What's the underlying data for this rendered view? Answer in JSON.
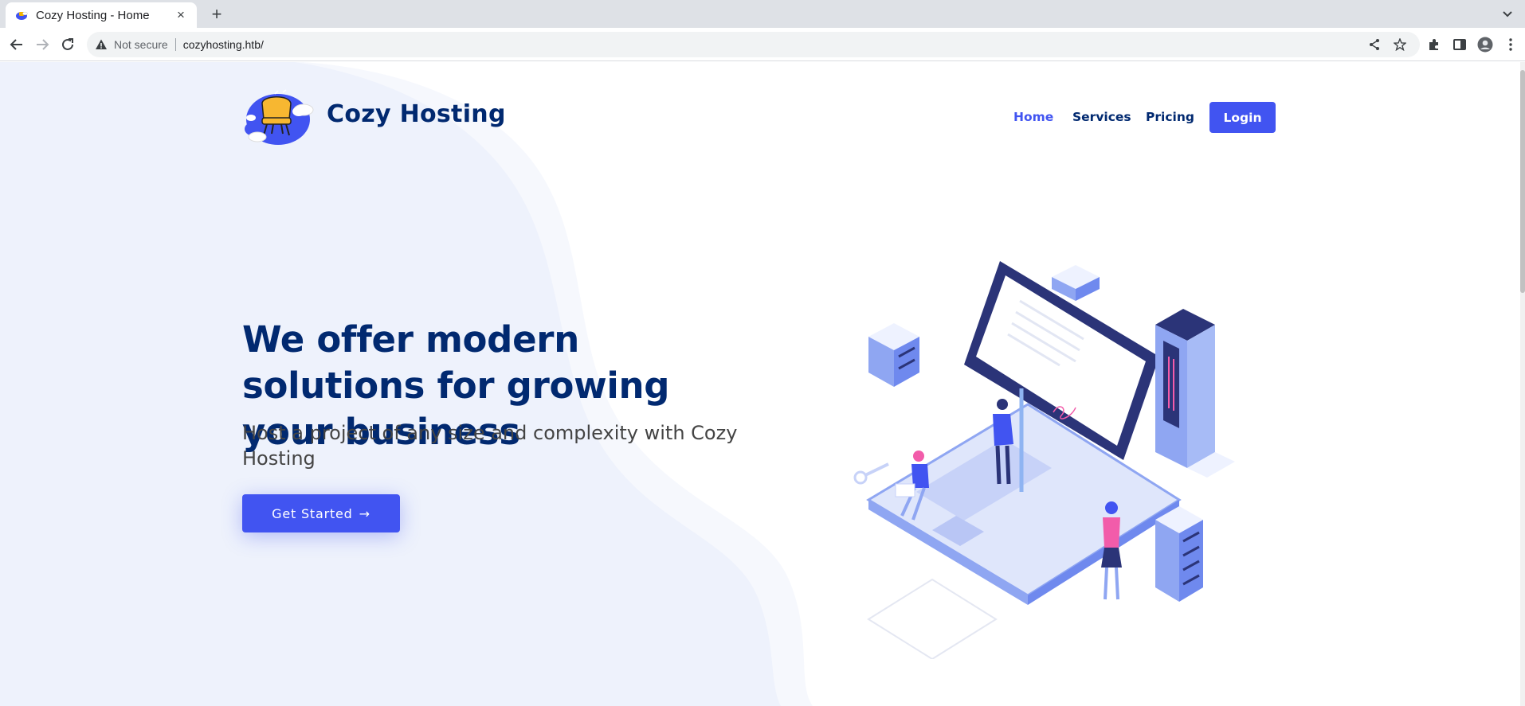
{
  "browser": {
    "tab_title": "Cozy Hosting - Home",
    "new_tab_label": "+",
    "close_label": "×",
    "security_label": "Not secure",
    "url": "cozyhosting.htb/"
  },
  "site": {
    "brand": "Cozy Hosting",
    "nav": {
      "home": "Home",
      "services": "Services",
      "pricing": "Pricing",
      "login": "Login"
    },
    "hero": {
      "title": "We offer modern solutions for growing your business",
      "subtitle": "Host a project of any size and complexity with Cozy Hosting",
      "cta": "Get Started",
      "cta_arrow": "→"
    }
  },
  "colors": {
    "primary": "#4154f1",
    "heading": "#012970",
    "hero_bg": "#f0f3fc"
  },
  "icons": [
    "back-icon",
    "forward-icon",
    "reload-icon",
    "warning-icon",
    "share-icon",
    "star-icon",
    "extensions-icon",
    "side-panel-icon",
    "profile-icon",
    "menu-icon",
    "tab-search-icon"
  ]
}
